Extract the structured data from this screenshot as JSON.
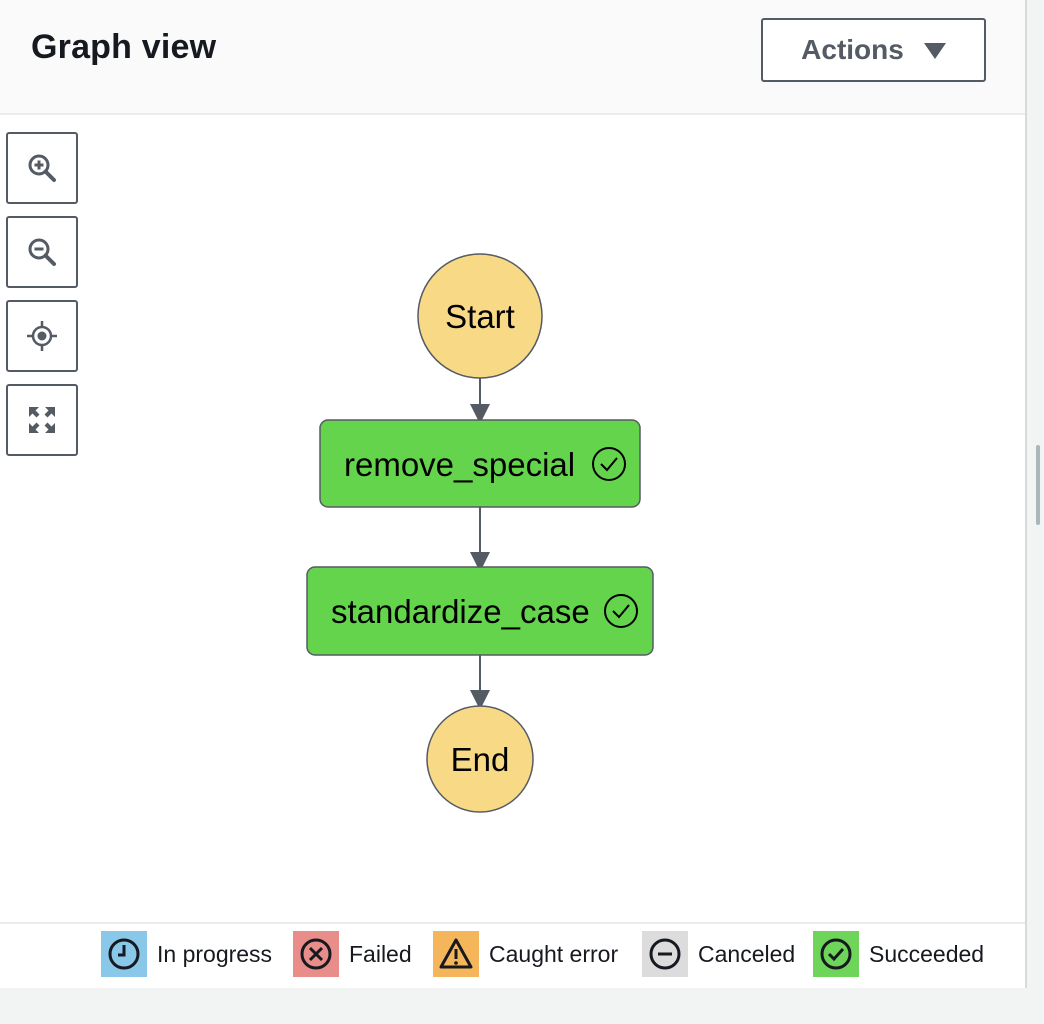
{
  "header": {
    "title": "Graph view",
    "actions_label": "Actions"
  },
  "toolbar": {
    "icons": [
      "zoom-in-icon",
      "zoom-out-icon",
      "center-icon",
      "fit-to-screen-icon"
    ]
  },
  "graph": {
    "nodes": [
      {
        "id": "start",
        "label": "Start",
        "shape": "circle",
        "color": "#f8d985"
      },
      {
        "id": "remove_special",
        "label": "remove_special",
        "shape": "rect",
        "status": "succeeded",
        "color": "#64d44d"
      },
      {
        "id": "standardize_case",
        "label": "standardize_case",
        "shape": "rect",
        "status": "succeeded",
        "color": "#64d44d"
      },
      {
        "id": "end",
        "label": "End",
        "shape": "circle",
        "color": "#f8d985"
      }
    ],
    "edges": [
      {
        "from": "start",
        "to": "remove_special"
      },
      {
        "from": "remove_special",
        "to": "standardize_case"
      },
      {
        "from": "standardize_case",
        "to": "end"
      }
    ]
  },
  "legend": [
    {
      "label": "In progress",
      "color": "#89c8e8",
      "icon": "clock-icon"
    },
    {
      "label": "Failed",
      "color": "#e98d8a",
      "icon": "x-circle-icon"
    },
    {
      "label": "Caught error",
      "color": "#f5b55a",
      "icon": "warning-icon"
    },
    {
      "label": "Canceled",
      "color": "#dcdcdc",
      "icon": "minus-circle-icon"
    },
    {
      "label": "Succeeded",
      "color": "#6ed45a",
      "icon": "check-circle-icon"
    }
  ]
}
